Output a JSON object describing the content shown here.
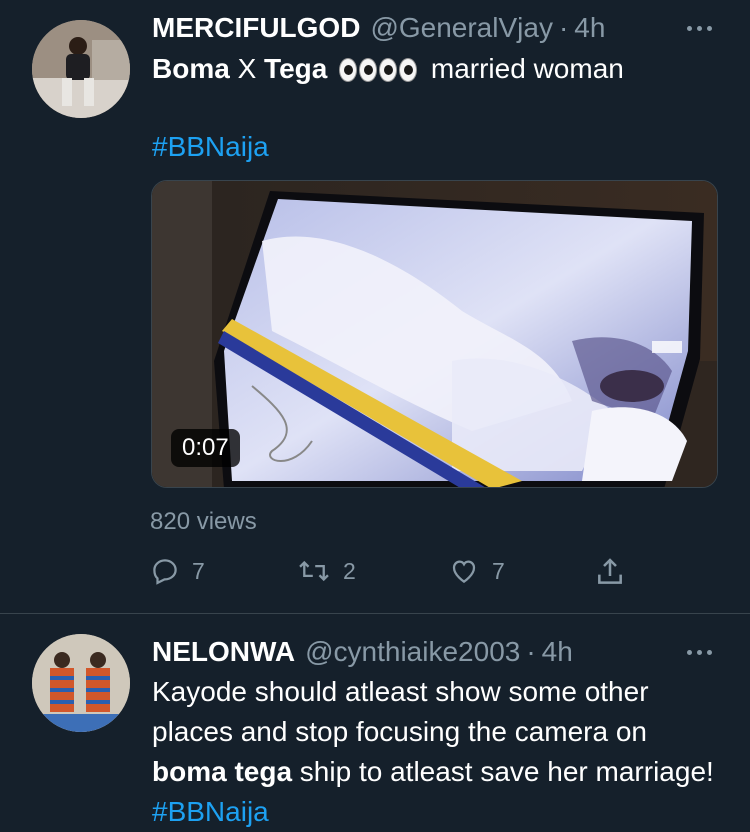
{
  "tweets": [
    {
      "display_name": "MERCIFULGOD",
      "handle": "@GeneralVjay",
      "separator": "·",
      "time": "4h",
      "text_bold": "Boma",
      "text_plain": "X",
      "text_bold2": "Tega",
      "text_after": "married woman",
      "hashtag": "#BBNaija",
      "video_duration": "0:07",
      "views": "820 views",
      "reply_count": "7",
      "retweet_count": "2",
      "like_count": "7"
    },
    {
      "display_name": "NELONWA",
      "handle": "@cynthiaike2003",
      "separator": "·",
      "time": "4h",
      "text_part1": "Kayode should atleast show some other places and stop focusing the camera on ",
      "text_bold": "boma tega",
      "text_part2": " ship to atleast save her marriage! ",
      "hashtag": "#BBNaija"
    }
  ],
  "icons": {
    "more": "more-horizontal-icon",
    "reply": "reply-icon",
    "retweet": "retweet-icon",
    "like": "heart-icon",
    "share": "share-icon",
    "eyes_emoji": "eyes-emoji-icon"
  },
  "colors": {
    "background": "#15202b",
    "secondary_text": "#8899a6",
    "link": "#1da1f2",
    "divider": "#38444d"
  }
}
